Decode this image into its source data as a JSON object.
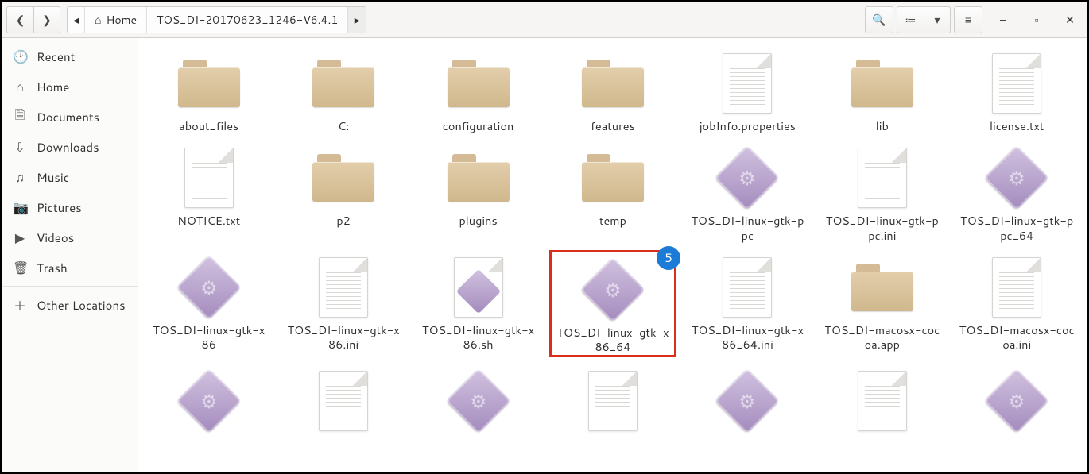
{
  "path": {
    "home": "Home",
    "folder": "TOS_DI-20170623_1246-V6.4.1"
  },
  "sidebar": {
    "items": [
      {
        "icon": "🕑",
        "label": "Recent"
      },
      {
        "icon": "⌂",
        "label": "Home"
      },
      {
        "icon": "🗎",
        "label": "Documents"
      },
      {
        "icon": "⇩",
        "label": "Downloads"
      },
      {
        "icon": "♫",
        "label": "Music"
      },
      {
        "icon": "📷",
        "label": "Pictures"
      },
      {
        "icon": "▶",
        "label": "Videos"
      },
      {
        "icon": "🗑",
        "label": "Trash"
      }
    ],
    "other": {
      "icon": "＋",
      "label": "Other Locations"
    }
  },
  "files": [
    {
      "type": "folder",
      "name": "about_files"
    },
    {
      "type": "folder",
      "name": "C:"
    },
    {
      "type": "folder",
      "name": "configuration"
    },
    {
      "type": "folder",
      "name": "features"
    },
    {
      "type": "text",
      "name": "jobInfo.properties"
    },
    {
      "type": "folder",
      "name": "lib"
    },
    {
      "type": "text",
      "name": "license.txt"
    },
    {
      "type": "text",
      "name": "NOTICE.txt"
    },
    {
      "type": "folder",
      "name": "p2"
    },
    {
      "type": "folder",
      "name": "plugins"
    },
    {
      "type": "folder",
      "name": "temp"
    },
    {
      "type": "exec",
      "name": "TOS_DI-linux-gtk-ppc"
    },
    {
      "type": "text",
      "name": "TOS_DI-linux-gtk-ppc.ini"
    },
    {
      "type": "exec",
      "name": "TOS_DI-linux-gtk-ppc_64"
    },
    {
      "type": "exec",
      "name": "TOS_DI-linux-gtk-x86"
    },
    {
      "type": "text",
      "name": "TOS_DI-linux-gtk-x86.ini"
    },
    {
      "type": "sh",
      "name": "TOS_DI-linux-gtk-x86.sh"
    },
    {
      "type": "exec",
      "name": "TOS_DI-linux-gtk-x86_64",
      "highlight": true,
      "badge": "5"
    },
    {
      "type": "text",
      "name": "TOS_DI-linux-gtk-x86_64.ini"
    },
    {
      "type": "folder",
      "name": "TOS_DI-macosx-cocoa.app"
    },
    {
      "type": "text",
      "name": "TOS_DI-macosx-cocoa.ini"
    },
    {
      "type": "exec",
      "name": ""
    },
    {
      "type": "text",
      "name": ""
    },
    {
      "type": "exec",
      "name": ""
    },
    {
      "type": "text",
      "name": ""
    },
    {
      "type": "exec",
      "name": ""
    },
    {
      "type": "text",
      "name": ""
    },
    {
      "type": "exec",
      "name": ""
    }
  ]
}
